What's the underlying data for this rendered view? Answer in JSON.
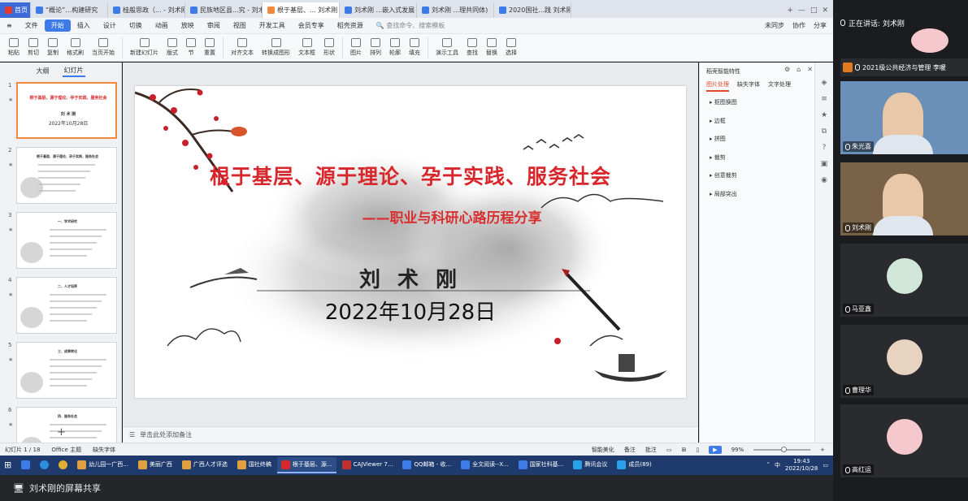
{
  "tabs": [
    {
      "label": "首页",
      "color": "#e23a2e",
      "home": true
    },
    {
      "label": "“概论”…构建研究",
      "color": "#3c7be8"
    },
    {
      "label": "桂般思政（... - 刘术刚",
      "color": "#3c7be8"
    },
    {
      "label": "民族地区县...究 - 刘术刚",
      "color": "#3c7be8"
    },
    {
      "label": "根于基层、... 刘术刚",
      "color": "#f08a3c",
      "active": true
    },
    {
      "label": "刘术刚 ...嵌入式发展",
      "color": "#3c7be8"
    },
    {
      "label": "刘术刚 ...理共同体)",
      "color": "#3c7be8"
    },
    {
      "label": "2020国社...践 刘术刚",
      "color": "#3c7be8"
    }
  ],
  "menu": [
    "文件",
    "开始",
    "插入",
    "设计",
    "切换",
    "动画",
    "放映",
    "审阅",
    "视图",
    "开发工具",
    "会员专享",
    "稻壳资源"
  ],
  "menu_active": "开始",
  "menu_search": "查找命令、搜索模板",
  "menu_right": [
    "未同步",
    "协作",
    "分享"
  ],
  "ribbon": [
    "粘贴",
    "剪切",
    "复制",
    "格式刷",
    "当页开始",
    "新建幻灯片",
    "版式",
    "节",
    "重置",
    "对齐文本",
    "转换成图形",
    "文本框",
    "形状",
    "图片",
    "排列",
    "轮廓",
    "填充",
    "演示工具",
    "查找",
    "替换",
    "选择"
  ],
  "left_tabs": [
    "大纲",
    "幻灯片"
  ],
  "slides": [
    {
      "num": "1",
      "title": "根于基层、源于理论、孕于实践、服务社会",
      "name": "刘 术 刚",
      "date": "2022年10月28日"
    },
    {
      "num": "2",
      "title": "根于基层、源于理论、孕于实践、服务社会"
    },
    {
      "num": "3",
      "title": "一、学术研究"
    },
    {
      "num": "4",
      "title": "二、人才培养"
    },
    {
      "num": "5",
      "title": "三、成果转化"
    },
    {
      "num": "6",
      "title": "四、服务社会"
    }
  ],
  "slide": {
    "title": "根于基层、源于理论、孕于实践、服务社会",
    "subtitle": "——职业与科研心路历程分享",
    "name": "刘 术 刚",
    "date": "2022年10月28日",
    "title_color": "#d8272c"
  },
  "notes": "单击此处添加备注",
  "right_pane": {
    "title": "稻壳智能特性",
    "tabs": [
      "图片处理",
      "缺失字体",
      "文字处理"
    ],
    "items": [
      "抠图换图",
      "边框",
      "拼图",
      "裁剪",
      "创意裁剪",
      "局部突出"
    ]
  },
  "status": {
    "slide": "幻灯片 1 / 18",
    "theme": "Office 主题",
    "font": "缺失字体",
    "beautify": "智能美化",
    "notes": "备注",
    "comment": "批注",
    "zoom": "99%"
  },
  "taskbar": [
    {
      "label": "幼儿园一广西...",
      "color": "#e0a040"
    },
    {
      "label": "美丽广西",
      "color": "#e0a040"
    },
    {
      "label": "广西人才评选",
      "color": "#e0a040"
    },
    {
      "label": "国社终稿",
      "color": "#e0a040"
    },
    {
      "label": "根于基层、源...",
      "color": "#d8272c",
      "active": true
    },
    {
      "label": "CAJViewer 7...",
      "color": "#c03030"
    },
    {
      "label": "QQ邮箱 - 收...",
      "color": "#3c7be8"
    },
    {
      "label": "全文阅读--X...",
      "color": "#3c7be8"
    },
    {
      "label": "国家社科基...",
      "color": "#3c7be8"
    },
    {
      "label": "腾讯会议",
      "color": "#2aa0e8"
    },
    {
      "label": "成员(89)",
      "color": "#2aa0e8"
    }
  ],
  "clock": {
    "time": "19:43",
    "date": "2022/10/28"
  },
  "tray_lang": "中",
  "share_text": "刘术刚的屏幕共享",
  "speaking": "正在讲话: 刘术刚",
  "participants": [
    {
      "name": "2021级公共经济与管理 李暖",
      "kind": "label"
    },
    {
      "name": "朱光喜",
      "kind": "video",
      "bg": "#6a8fb8"
    },
    {
      "name": "刘术刚",
      "kind": "video",
      "bg": "#7a6248"
    },
    {
      "name": "马亚鑫",
      "kind": "avatar",
      "color": "#cfe6d8"
    },
    {
      "name": "曹理华",
      "kind": "avatar",
      "color": "#e8d2c0"
    },
    {
      "name": "高红运",
      "kind": "avatar",
      "color": "#f4c8cc"
    }
  ]
}
